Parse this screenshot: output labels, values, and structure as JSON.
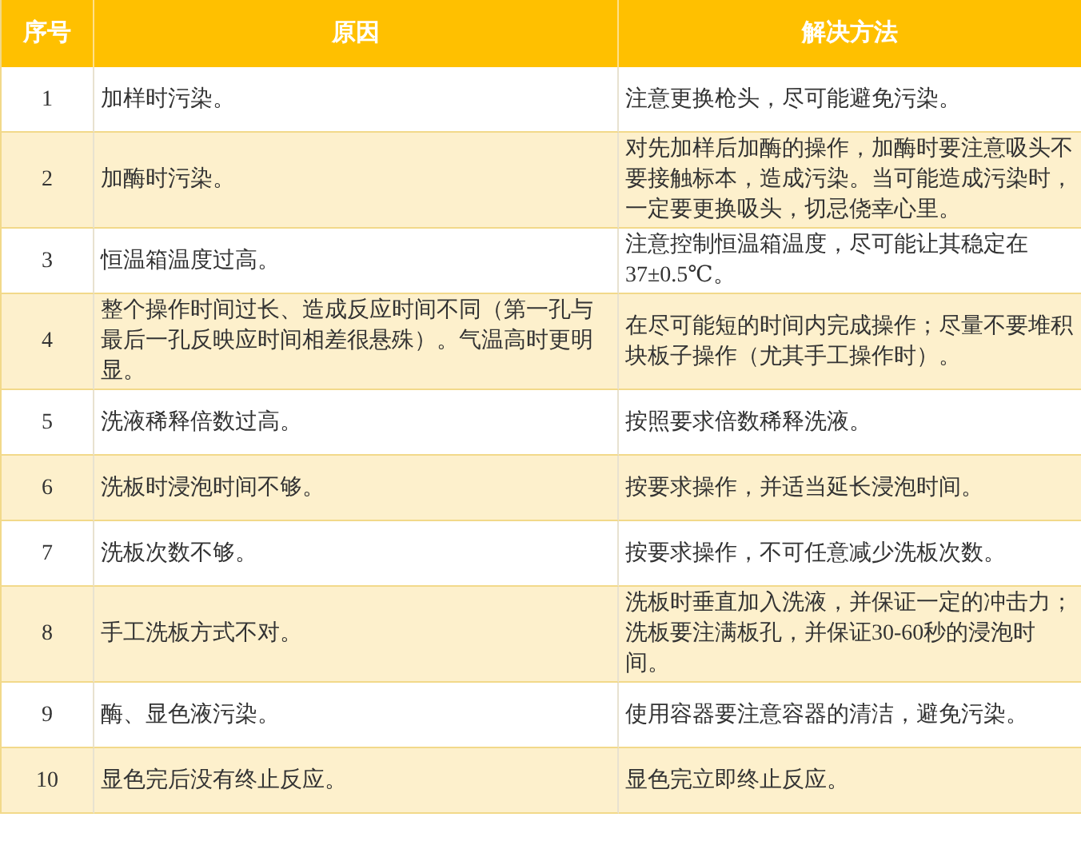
{
  "table": {
    "columns": [
      "序号",
      "原因",
      "解决方法"
    ],
    "rows": [
      {
        "number": "1",
        "cause": "加样时污染。",
        "solution": "注意更换枪头，尽可能避免污染。"
      },
      {
        "number": "2",
        "cause": "加酶时污染。",
        "solution": "对先加样后加酶的操作，加酶时要注意吸头不要接触标本，造成污染。当可能造成污染时，一定要更换吸头，切忌侥幸心里。"
      },
      {
        "number": "3",
        "cause": "恒温箱温度过高。",
        "solution": "注意控制恒温箱温度，尽可能让其稳定在37±0.5℃。"
      },
      {
        "number": "4",
        "cause": "整个操作时间过长、造成反应时间不同（第一孔与最后一孔反映应时间相差很悬殊）。气温高时更明显。",
        "solution": "在尽可能短的时间内完成操作；尽量不要堆积块板子操作（尤其手工操作时）。"
      },
      {
        "number": "5",
        "cause": "洗液稀释倍数过高。",
        "solution": "按照要求倍数稀释洗液。"
      },
      {
        "number": "6",
        "cause": "洗板时浸泡时间不够。",
        "solution": "按要求操作，并适当延长浸泡时间。"
      },
      {
        "number": "7",
        "cause": "洗板次数不够。",
        "solution": "按要求操作，不可任意减少洗板次数。"
      },
      {
        "number": "8",
        "cause": "手工洗板方式不对。",
        "solution": "洗板时垂直加入洗液，并保证一定的冲击力；洗板要注满板孔，并保证30-60秒的浸泡时间。"
      },
      {
        "number": "9",
        "cause": "酶、显色液污染。",
        "solution": "使用容器要注意容器的清洁，避免污染。"
      },
      {
        "number": "10",
        "cause": "显色完后没有终止反应。",
        "solution": "显色完立即终止反应。"
      }
    ]
  }
}
